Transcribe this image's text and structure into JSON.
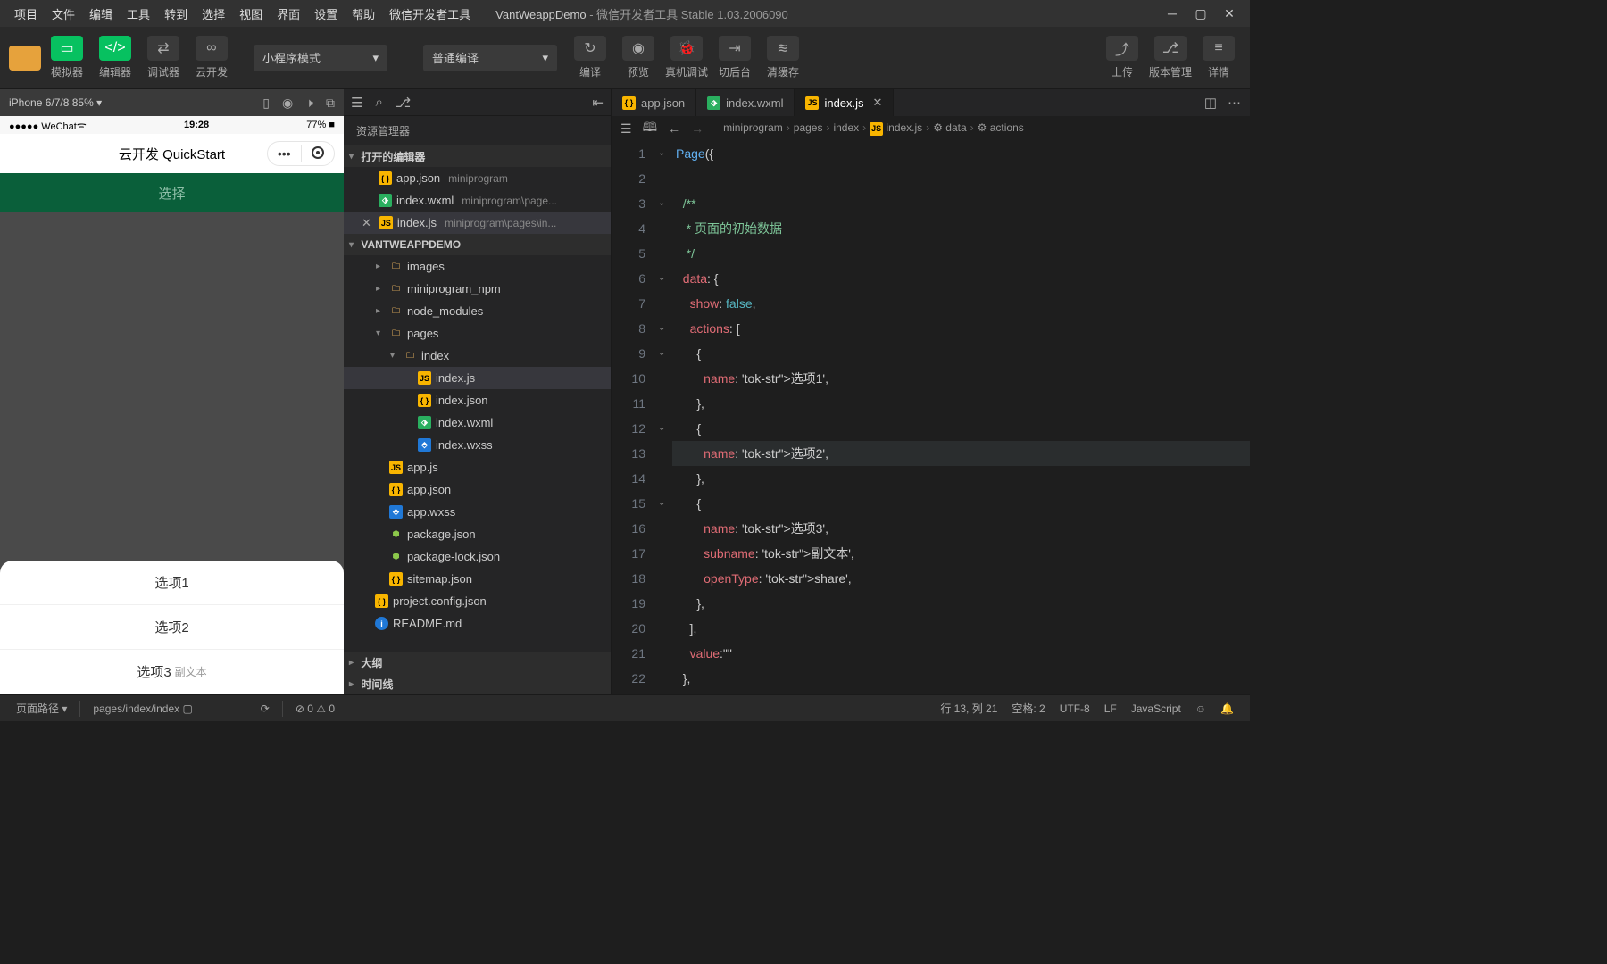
{
  "menu": [
    "项目",
    "文件",
    "编辑",
    "工具",
    "转到",
    "选择",
    "视图",
    "界面",
    "设置",
    "帮助",
    "微信开发者工具"
  ],
  "title": {
    "project": "VantWeappDemo",
    "suffix": " - 微信开发者工具 Stable 1.03.2006090"
  },
  "toolbar": {
    "simulator": "模拟器",
    "editor": "编辑器",
    "debugger": "调试器",
    "cloud": "云开发",
    "mode": "小程序模式",
    "compile": "普通编译",
    "compileBtn": "编译",
    "preview": "预览",
    "realDevice": "真机调试",
    "background": "切后台",
    "clearCache": "清缓存",
    "upload": "上传",
    "version": "版本管理",
    "details": "详情"
  },
  "sim": {
    "device": "iPhone 6/7/8 85%",
    "arrow": "▾",
    "statusLeft": "●●●●● WeChat",
    "wifi": "⌤",
    "time": "19:28",
    "battery": "77%",
    "navTitle": "云开发 QuickStart",
    "chooseLabel": "选择",
    "sheet": [
      {
        "title": "选项1",
        "sub": ""
      },
      {
        "title": "选项2",
        "sub": ""
      },
      {
        "title": "选项3",
        "sub": "副文本"
      }
    ]
  },
  "explorer": {
    "title": "资源管理器",
    "openEditors": "打开的编辑器",
    "openFiles": [
      {
        "name": "app.json",
        "path": "miniprogram",
        "type": "json"
      },
      {
        "name": "index.wxml",
        "path": "miniprogram\\page...",
        "type": "wxml"
      },
      {
        "name": "index.js",
        "path": "miniprogram\\pages\\in...",
        "type": "js",
        "close": true
      }
    ],
    "rootName": "VANTWEAPPDEMO",
    "tree": [
      {
        "indent": 1,
        "chev": "▸",
        "ico": "folder-img",
        "name": "images"
      },
      {
        "indent": 1,
        "chev": "▸",
        "ico": "folder",
        "name": "miniprogram_npm"
      },
      {
        "indent": 1,
        "chev": "▸",
        "ico": "folder-node",
        "name": "node_modules"
      },
      {
        "indent": 1,
        "chev": "▾",
        "ico": "folder-open",
        "name": "pages"
      },
      {
        "indent": 2,
        "chev": "▾",
        "ico": "folder",
        "name": "index"
      },
      {
        "indent": 3,
        "chev": "",
        "ico": "js",
        "name": "index.js",
        "active": true
      },
      {
        "indent": 3,
        "chev": "",
        "ico": "json",
        "name": "index.json"
      },
      {
        "indent": 3,
        "chev": "",
        "ico": "wxml",
        "name": "index.wxml"
      },
      {
        "indent": 3,
        "chev": "",
        "ico": "wxss",
        "name": "index.wxss"
      },
      {
        "indent": 1,
        "chev": "",
        "ico": "js",
        "name": "app.js"
      },
      {
        "indent": 1,
        "chev": "",
        "ico": "json",
        "name": "app.json"
      },
      {
        "indent": 1,
        "chev": "",
        "ico": "wxss",
        "name": "app.wxss"
      },
      {
        "indent": 1,
        "chev": "",
        "ico": "node",
        "name": "package.json"
      },
      {
        "indent": 1,
        "chev": "",
        "ico": "node",
        "name": "package-lock.json"
      },
      {
        "indent": 1,
        "chev": "",
        "ico": "json",
        "name": "sitemap.json"
      },
      {
        "indent": 0,
        "chev": "",
        "ico": "json",
        "name": "project.config.json"
      },
      {
        "indent": 0,
        "chev": "",
        "ico": "info",
        "name": "README.md"
      }
    ],
    "outline": "大纲",
    "timeline": "时间线"
  },
  "editorTabs": [
    {
      "name": "app.json",
      "ico": "json"
    },
    {
      "name": "index.wxml",
      "ico": "wxml"
    },
    {
      "name": "index.js",
      "ico": "js",
      "active": true,
      "close": true
    }
  ],
  "breadcrumb": [
    "miniprogram",
    "pages",
    "index",
    "index.js",
    "data",
    "actions"
  ],
  "code": {
    "lines": [
      "Page({",
      "",
      "  /**",
      "   * 页面的初始数据",
      "   */",
      "  data: {",
      "    show: false,",
      "    actions: [",
      "      {",
      "        name: '选项1',",
      "      },",
      "      {",
      "        name: '选项2',",
      "      },",
      "      {",
      "        name: '选项3',",
      "        subname: '副文本',",
      "        openType: 'share',",
      "      },",
      "    ],",
      "    value:\"\"",
      "  },",
      ""
    ],
    "folds": {
      "1": "⌄",
      "3": "⌄",
      "6": "⌄",
      "8": "⌄",
      "9": "⌄",
      "12": "⌄",
      "15": "⌄"
    },
    "highlight": 13
  },
  "status": {
    "pathLabel": "页面路径",
    "path": "pages/index/index",
    "errors": "⊘ 0 ⚠ 0",
    "linecol": "行 13,  列 21",
    "spaces": "空格: 2",
    "encoding": "UTF-8",
    "eol": "LF",
    "lang": "JavaScript"
  }
}
